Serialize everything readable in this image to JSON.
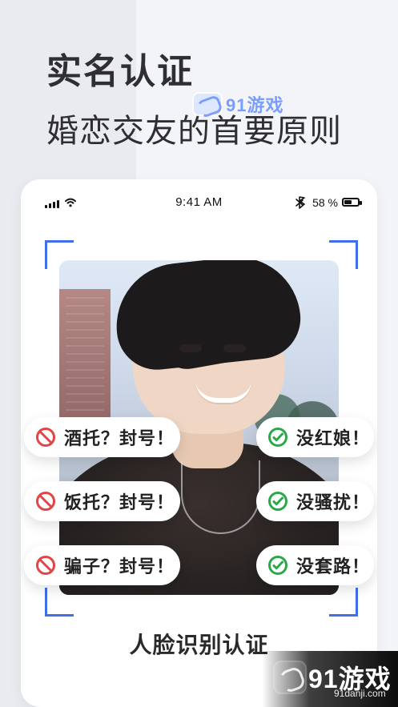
{
  "header": {
    "title": "实名认证",
    "subtitle": "婚恋交友的首要原则"
  },
  "watermarks": {
    "top_text": "91游戏",
    "bottom_brand": "91游戏",
    "bottom_domain": "91danji.com"
  },
  "status_bar": {
    "time": "9:41 AM",
    "battery_text": "58 %",
    "battery_level": 0.58,
    "icons": [
      "signal-icon",
      "wifi-icon",
      "bluetooth-icon",
      "battery-icon"
    ]
  },
  "pills": {
    "left": [
      {
        "text": "酒托？封号！",
        "icon": "ban-icon"
      },
      {
        "text": "饭托？封号！",
        "icon": "ban-icon"
      },
      {
        "text": "骗子？封号！",
        "icon": "ban-icon"
      }
    ],
    "right": [
      {
        "text": "没红娘！",
        "icon": "check-circle-icon"
      },
      {
        "text": "没骚扰！",
        "icon": "check-circle-icon"
      },
      {
        "text": "没套路！",
        "icon": "check-circle-icon"
      }
    ]
  },
  "card": {
    "bottom_title": "人脸识别认证"
  },
  "colors": {
    "accent_blue": "#3f6fe6",
    "ban_red": "#e24545",
    "check_green": "#2aa84a",
    "text_dark": "#2f2f33"
  }
}
